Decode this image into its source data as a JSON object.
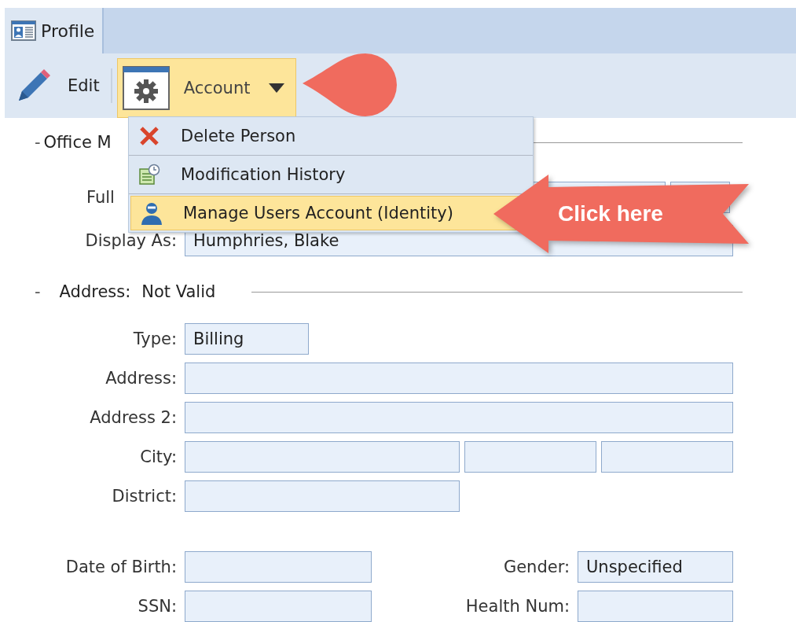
{
  "tabs": [
    {
      "label": "Profile",
      "selected": true
    }
  ],
  "toolbar": [
    {
      "label": "Edit",
      "kind": "edit"
    },
    {
      "label": "Account",
      "kind": "dropdown",
      "expanded": true
    }
  ],
  "menu": {
    "items": [
      {
        "label": "Delete Person",
        "kind": "delete",
        "selected": false
      },
      {
        "label": "Modification History",
        "kind": "history",
        "selected": false
      },
      {
        "label": "Manage Users Account (Identity)",
        "kind": "user",
        "selected": true
      }
    ]
  },
  "callout": {
    "text": "Click here"
  },
  "sections": [
    {
      "toggle": "-",
      "title": "Office M",
      "rows": [
        {
          "kind": "name",
          "label": "Full"
        },
        {
          "kind": "single",
          "label": "Display As:",
          "values": [
            "Humphries, Blake"
          ]
        }
      ]
    },
    {
      "toggle": "-",
      "title": "Address:",
      "status": "Not Valid",
      "rows": [
        {
          "kind": "short",
          "label": "Type:",
          "values": [
            "Billing"
          ]
        },
        {
          "kind": "single",
          "label": "Address:"
        },
        {
          "kind": "single",
          "label": "Address 2:"
        },
        {
          "kind": "city",
          "label": "City:"
        },
        {
          "kind": "medium",
          "label": "District:"
        },
        {
          "kind": "pair",
          "label": "Date of Birth:",
          "label2": "Gender:",
          "value2": "Unspecified"
        },
        {
          "kind": "pair",
          "label": "SSN:",
          "label2": "Health Num:"
        }
      ]
    }
  ]
}
